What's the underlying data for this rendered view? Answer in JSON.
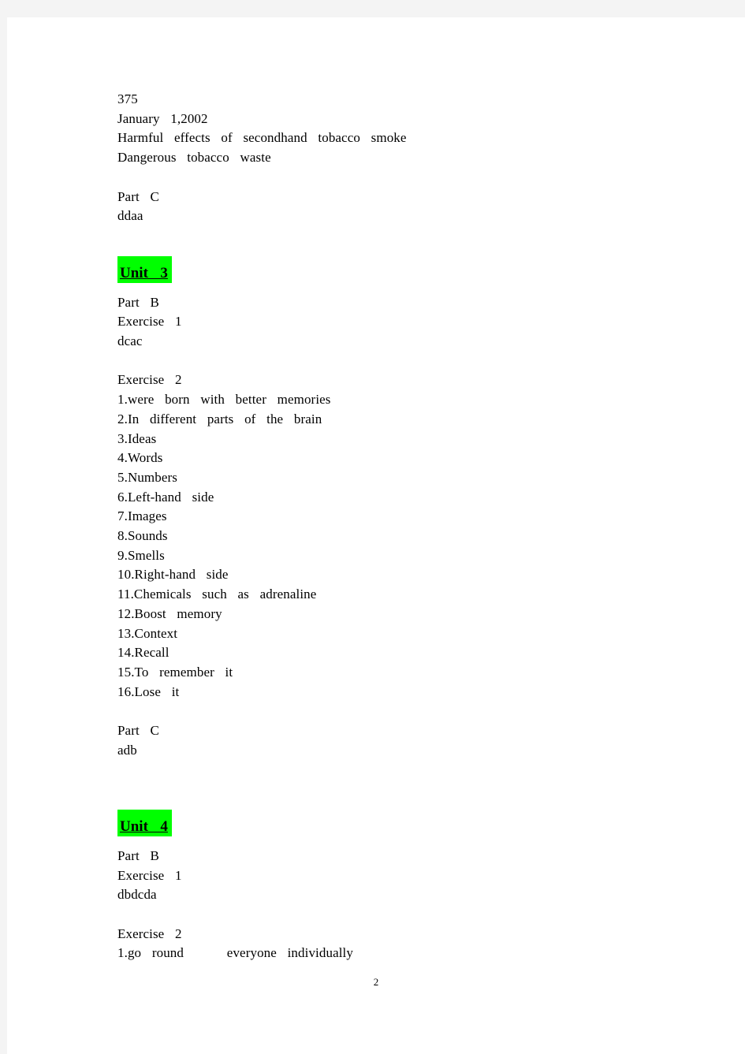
{
  "document": {
    "page_number": "2",
    "highlight_color": "#00ff00",
    "text_color": "#000000",
    "page_background": "#ffffff",
    "backdrop_color": "#f4f4f4"
  },
  "blocks": {
    "top_answers": {
      "line1": "375",
      "line2": "January  1,2002",
      "line3": "Harmful  effects  of  secondhand  tobacco  smoke",
      "line4": "Dangerous  tobacco  waste"
    },
    "top_part_c": {
      "heading": "Part  C",
      "answer": "ddaa"
    },
    "unit3": {
      "heading": "Unit  3",
      "part_b_heading": "Part  B",
      "exercise1_heading": "Exercise  1",
      "exercise1_answer": "dcac",
      "exercise2_heading": "Exercise  2",
      "exercise2_items": [
        "1.were  born  with  better  memories",
        "2.In  different  parts  of  the  brain",
        "3.Ideas",
        "4.Words",
        "5.Numbers",
        "6.Left-hand  side",
        "7.Images",
        "8.Sounds",
        "9.Smells",
        "10.Right-hand  side",
        "11.Chemicals  such  as  adrenaline",
        "12.Boost  memory",
        "13.Context",
        "14.Recall",
        "15.To  remember  it",
        "16.Lose  it"
      ],
      "part_c_heading": "Part  C",
      "part_c_answer": "adb"
    },
    "unit4": {
      "heading": "Unit  4",
      "part_b_heading": "Part  B",
      "exercise1_heading": "Exercise  1",
      "exercise1_answer": "dbdcda",
      "exercise2_heading": "Exercise  2",
      "exercise2_items": [
        "1.go  round        everyone  individually"
      ]
    }
  }
}
